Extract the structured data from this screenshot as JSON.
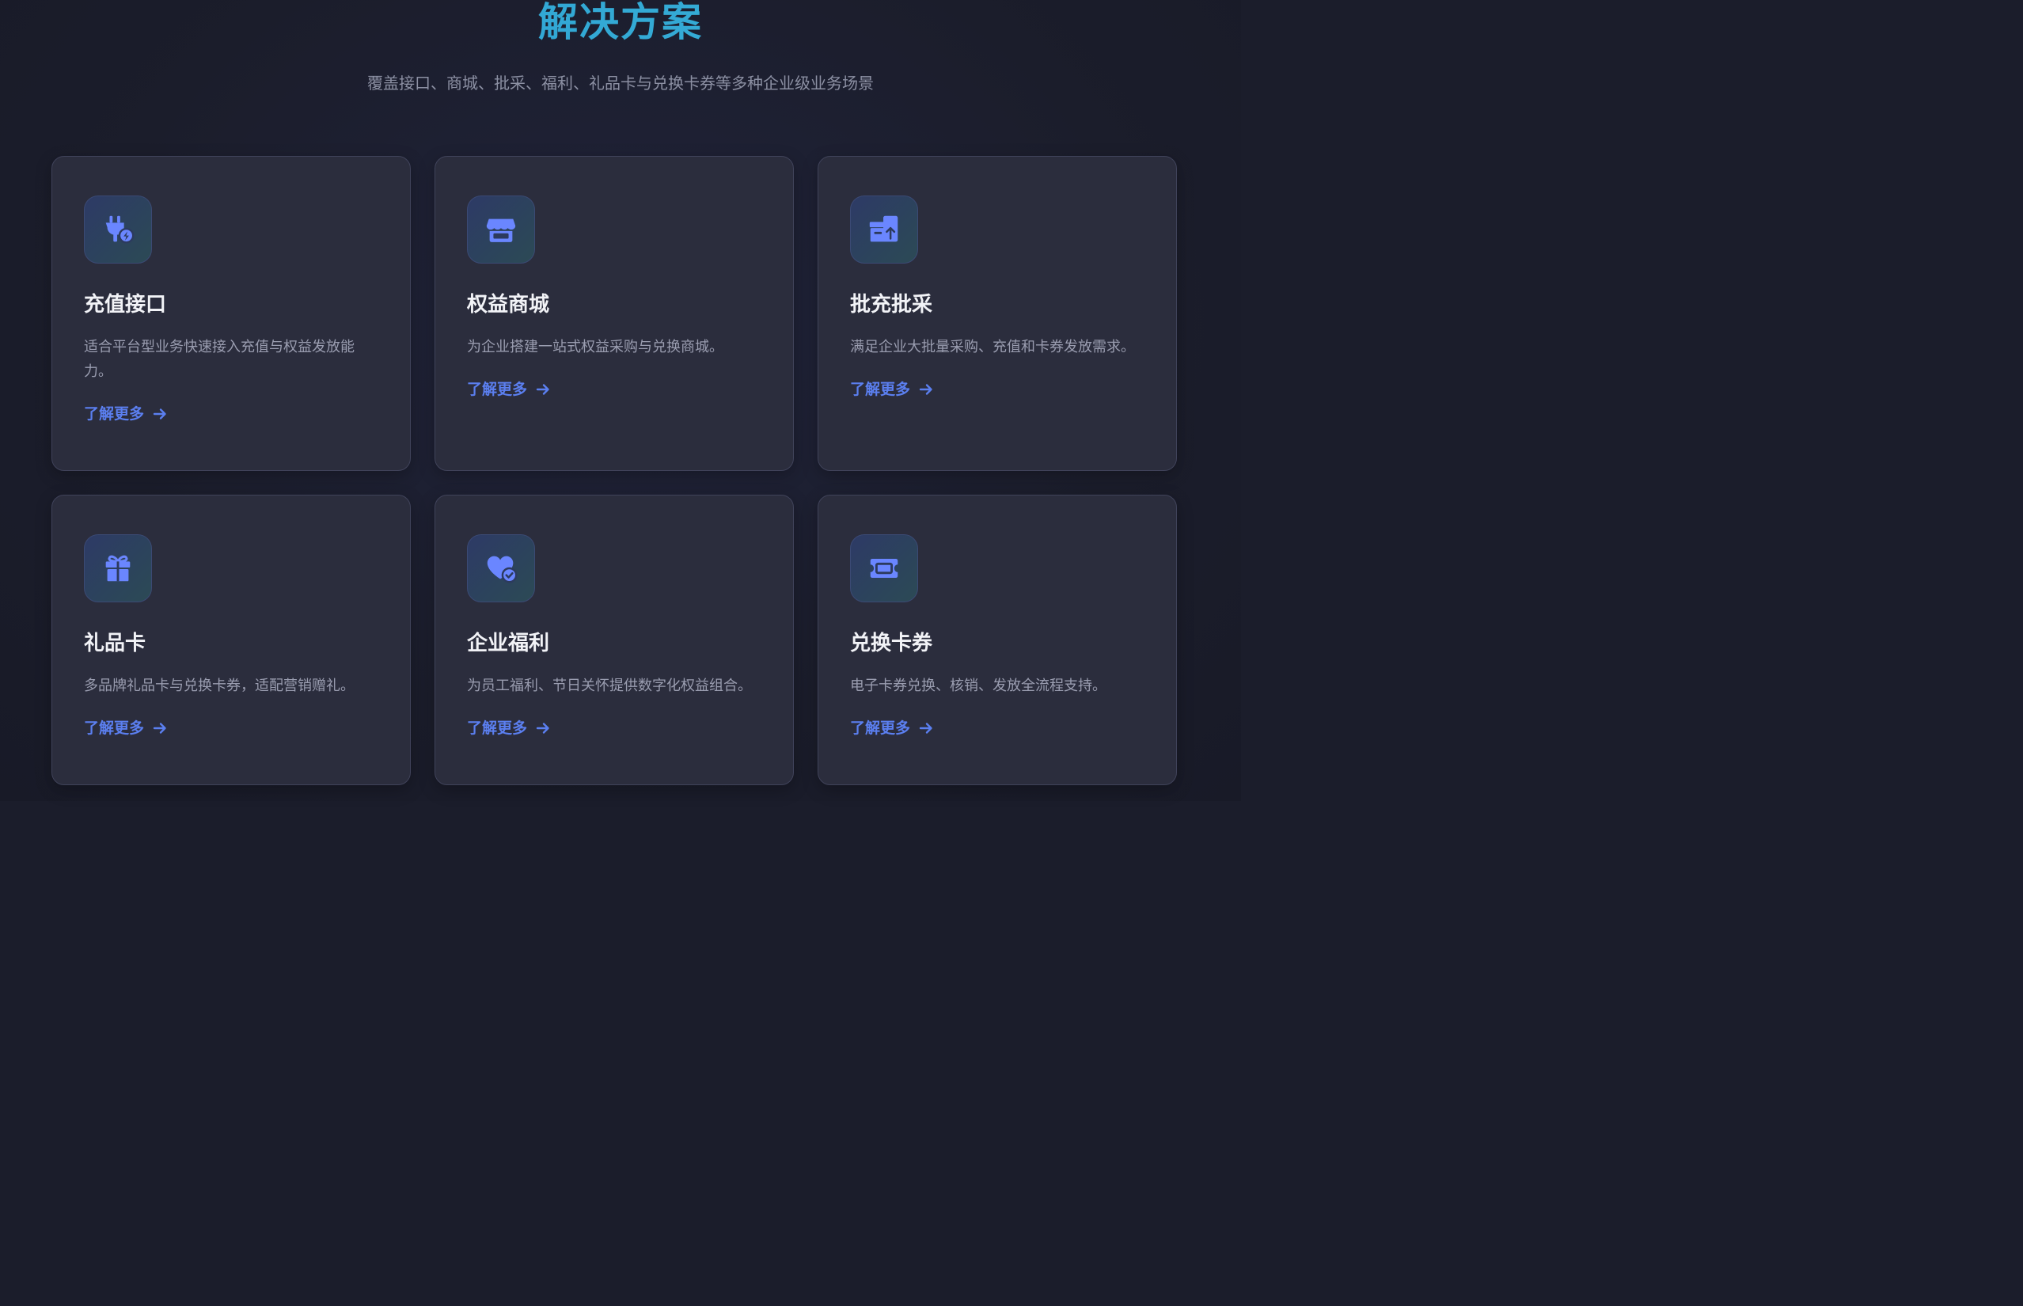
{
  "header": {
    "title": "解决方案",
    "subtitle": "覆盖接口、商城、批采、福利、礼品卡与兑换卡券等多种企业级业务场景"
  },
  "colors": {
    "title": "#2ea6d3",
    "accent": "#5b7ff0",
    "card_bg": "#2b2d3d",
    "page_bg": "#1b1d2b"
  },
  "solutions": [
    {
      "icon": "plug-charge-icon",
      "title": "充值接口",
      "description": "适合平台型业务快速接入充值与权益发放能力。",
      "link": "了解更多"
    },
    {
      "icon": "storefront-icon",
      "title": "权益商城",
      "description": "为企业搭建一站式权益采购与兑换商城。",
      "link": "了解更多"
    },
    {
      "icon": "boxes-upload-icon",
      "title": "批充批采",
      "description": "满足企业大批量采购、充值和卡券发放需求。",
      "link": "了解更多"
    },
    {
      "icon": "gift-icon",
      "title": "礼品卡",
      "description": "多品牌礼品卡与兑换卡券，适配营销赠礼。",
      "link": "了解更多"
    },
    {
      "icon": "heart-check-icon",
      "title": "企业福利",
      "description": "为员工福利、节日关怀提供数字化权益组合。",
      "link": "了解更多"
    },
    {
      "icon": "ticket-icon",
      "title": "兑换卡券",
      "description": "电子卡券兑换、核销、发放全流程支持。",
      "link": "了解更多"
    }
  ]
}
